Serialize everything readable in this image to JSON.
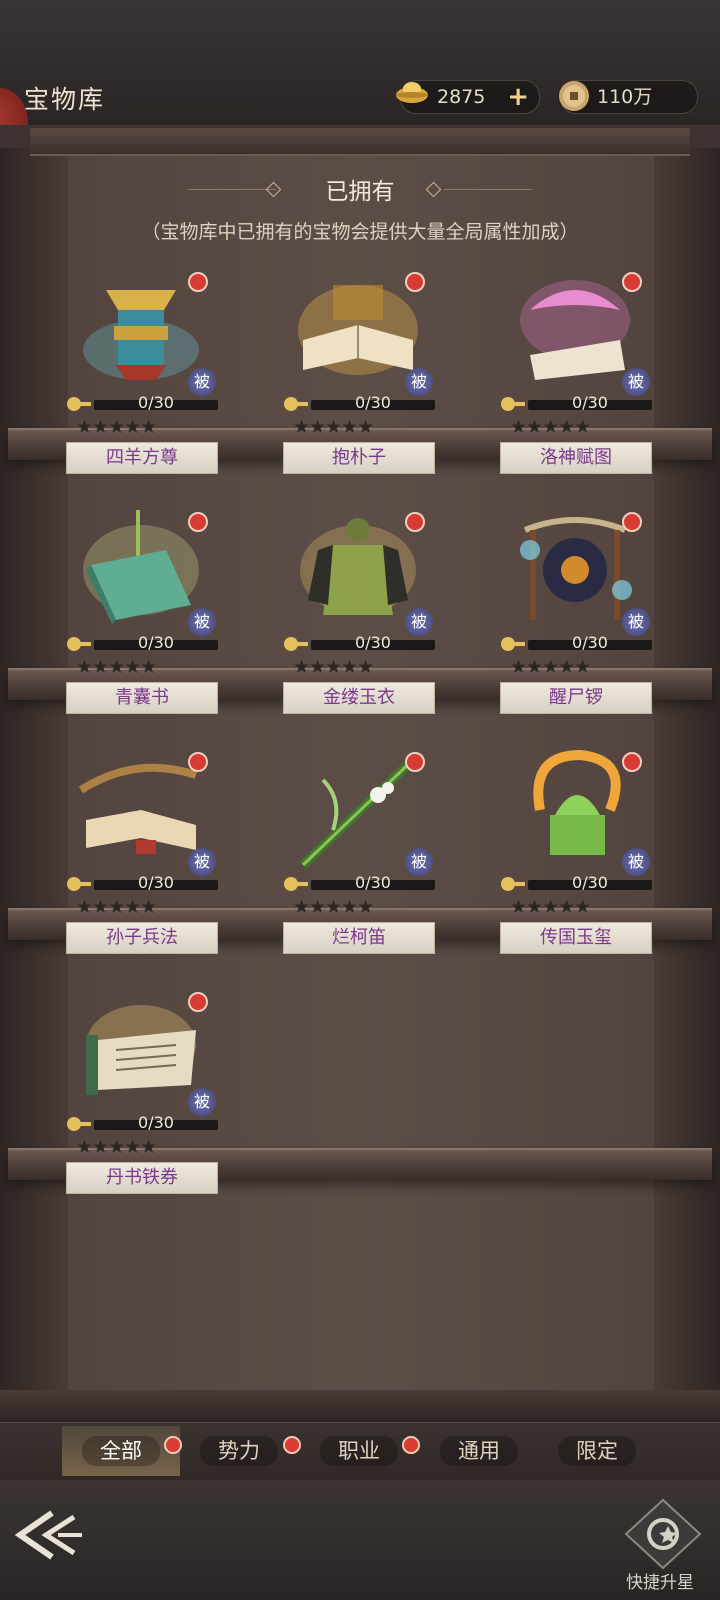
{
  "header": {
    "title": "宝物库",
    "gold": "2875",
    "coins": "110万"
  },
  "section": {
    "title": "已拥有",
    "subtitle": "（宝物库中已拥有的宝物会提供大量全局属性加成）"
  },
  "items": [
    {
      "name": "四羊方尊",
      "progress": "0/30",
      "badge": "被"
    },
    {
      "name": "抱朴子",
      "progress": "0/30",
      "badge": "被"
    },
    {
      "name": "洛神赋图",
      "progress": "0/30",
      "badge": "被"
    },
    {
      "name": "青囊书",
      "progress": "0/30",
      "badge": "被"
    },
    {
      "name": "金缕玉衣",
      "progress": "0/30",
      "badge": "被"
    },
    {
      "name": "醒尸锣",
      "progress": "0/30",
      "badge": "被"
    },
    {
      "name": "孙子兵法",
      "progress": "0/30",
      "badge": "被"
    },
    {
      "name": "烂柯笛",
      "progress": "0/30",
      "badge": "被"
    },
    {
      "name": "传国玉玺",
      "progress": "0/30",
      "badge": "被"
    },
    {
      "name": "丹书铁券",
      "progress": "0/30",
      "badge": "被"
    }
  ],
  "tabs": [
    "全部",
    "势力",
    "职业",
    "通用",
    "限定"
  ],
  "quick_upgrade": "快捷升星",
  "colors": {
    "accent_red": "#d83b32",
    "name_purple": "#7a3a8a"
  }
}
